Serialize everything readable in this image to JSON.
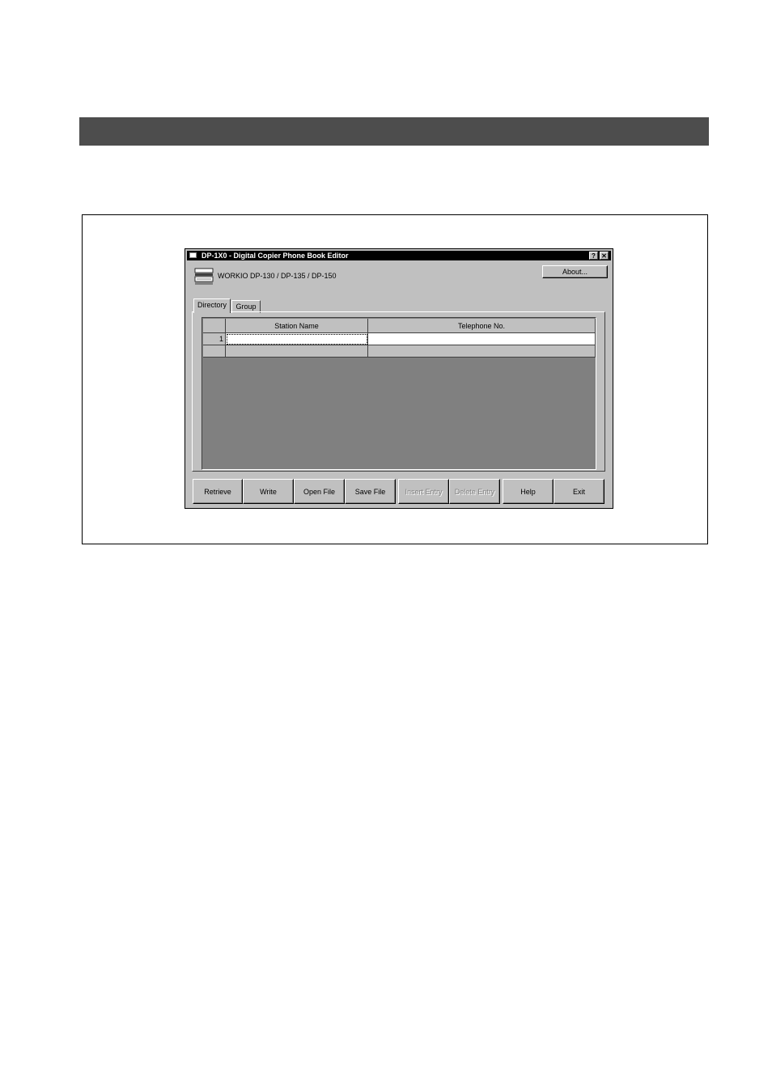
{
  "window": {
    "title": "DP-1X0 - Digital Copier Phone Book Editor",
    "help_glyph": "?",
    "close_glyph": "✕",
    "model_text": "WORKIO DP-130 / DP-135 / DP-150",
    "about_label": "About..."
  },
  "tabs": [
    {
      "label": "Directory",
      "selected": true
    },
    {
      "label": "Group",
      "selected": false
    }
  ],
  "grid": {
    "columns": [
      "Station Name",
      "Telephone No."
    ],
    "rows": [
      {
        "number": "1",
        "station_name": "",
        "telephone": ""
      }
    ]
  },
  "buttons": [
    {
      "label": "Retrieve",
      "enabled": true
    },
    {
      "label": "Write",
      "enabled": true
    },
    {
      "label": "Open File",
      "enabled": true
    },
    {
      "label": "Save File",
      "enabled": true
    },
    {
      "label": "Insert Entry",
      "enabled": false
    },
    {
      "label": "Delete Entry",
      "enabled": false
    },
    {
      "label": "Help",
      "enabled": true
    },
    {
      "label": "Exit",
      "enabled": true
    }
  ]
}
